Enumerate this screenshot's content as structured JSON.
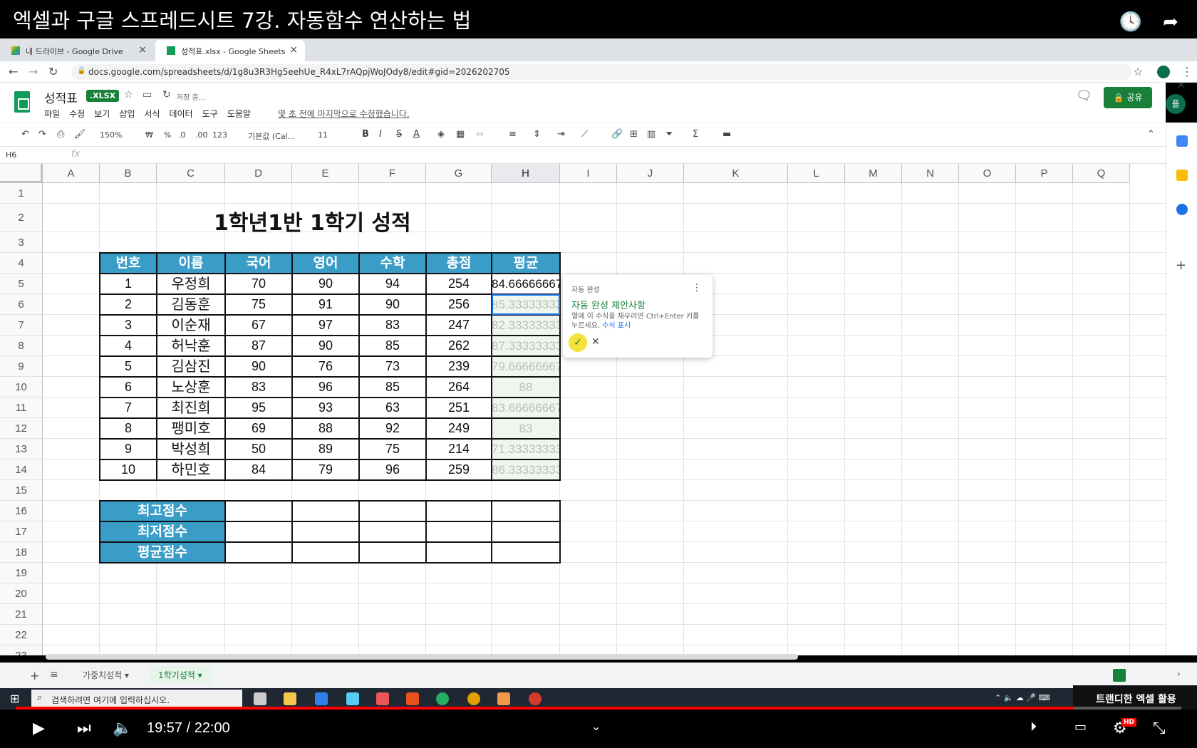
{
  "video": {
    "title": "엑셀과 구글 스프레드시트 7강. 자동함수 연산하는 법",
    "time": "19:57 / 22:00",
    "progress": 0.907,
    "channel": "트랜디한 엑셀 활용"
  },
  "browser": {
    "tabs": [
      {
        "label": "내 드라이브 - Google Drive"
      },
      {
        "label": "성적표.xlsx - Google Sheets"
      }
    ],
    "url": "docs.google.com/spreadsheets/d/1g8u3R3Hg5eehUe_R4xL7rAQpjWoJOdy8/edit#gid=2026202705"
  },
  "sheets": {
    "doc_title": "성적표",
    "badge": ".XLSX",
    "saving": "저장 중...",
    "menu": [
      "파일",
      "수정",
      "보기",
      "삽입",
      "서식",
      "데이터",
      "도구",
      "도움말"
    ],
    "last_edit": "몇 초 전에 마지막으로 수정했습니다.",
    "share": "공유",
    "avatar": "플",
    "toolbar": {
      "zoom": "150%",
      "currency": "₩",
      "percent": "%",
      "dec_less": ".0",
      "dec_more": ".00",
      "fmt": "123",
      "font": "기본값 (Cal...",
      "size": "11"
    },
    "name_box": "H6",
    "fx": "fx"
  },
  "grid": {
    "columns": [
      "A",
      "B",
      "C",
      "D",
      "E",
      "F",
      "G",
      "H",
      "I",
      "J",
      "K",
      "L",
      "M",
      "N",
      "O",
      "P",
      "Q"
    ],
    "rows": [
      "1",
      "2",
      "3",
      "4",
      "5",
      "6",
      "7",
      "8",
      "9",
      "10",
      "11",
      "12",
      "13",
      "14",
      "15",
      "16",
      "17",
      "18",
      "19",
      "20",
      "21",
      "22",
      "23"
    ],
    "title": "1학년1반 1학기 성적",
    "headers": [
      "번호",
      "이름",
      "국어",
      "영어",
      "수학",
      "총점",
      "평균"
    ],
    "students": [
      [
        "1",
        "우정희",
        "70",
        "90",
        "94",
        "254",
        "84.66666667"
      ],
      [
        "2",
        "김동훈",
        "75",
        "91",
        "90",
        "256",
        "85.33333333"
      ],
      [
        "3",
        "이순재",
        "67",
        "97",
        "83",
        "247",
        "82.33333333"
      ],
      [
        "4",
        "허낙훈",
        "87",
        "90",
        "85",
        "262",
        "87.33333333"
      ],
      [
        "5",
        "김삼진",
        "90",
        "76",
        "73",
        "239",
        "79.66666667"
      ],
      [
        "6",
        "노상훈",
        "83",
        "96",
        "85",
        "264",
        "88"
      ],
      [
        "7",
        "최진희",
        "95",
        "93",
        "63",
        "251",
        "83.66666667"
      ],
      [
        "8",
        "팽미호",
        "69",
        "88",
        "92",
        "249",
        "83"
      ],
      [
        "9",
        "박성희",
        "50",
        "89",
        "75",
        "214",
        "71.33333333"
      ],
      [
        "10",
        "하민호",
        "84",
        "79",
        "96",
        "259",
        "86.33333333"
      ]
    ],
    "summary": [
      "최고점수",
      "최저점수",
      "평균점수"
    ]
  },
  "autocomplete": {
    "label": "자동 완성",
    "heading": "자동 완성 제안사항",
    "desc": "열에 이 수식을 채우려면 Ctrl+Enter 키를 누르세요.",
    "link": "수식 표시"
  },
  "sheet_tabs": [
    {
      "label": "가중치성적"
    },
    {
      "label": "1학기성적"
    }
  ],
  "taskbar": {
    "search": "검색하려면 여기에 입력하십시오."
  }
}
